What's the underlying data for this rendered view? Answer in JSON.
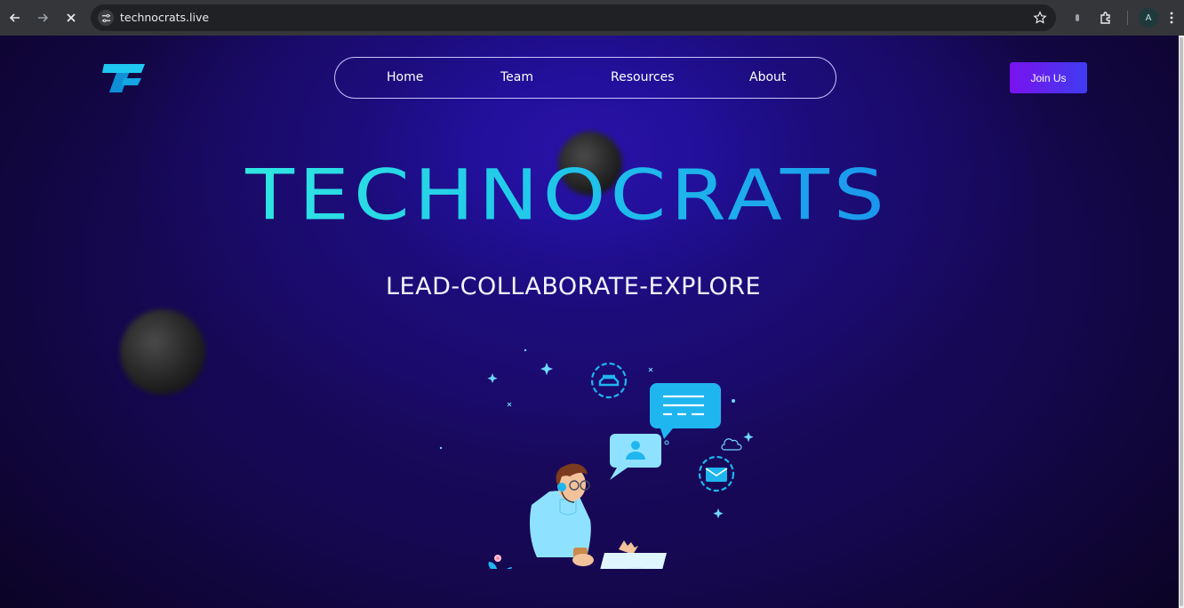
{
  "browser": {
    "url": "technocrats.live",
    "profile_initial": "A",
    "icons": [
      "back-icon",
      "forward-icon",
      "close-icon",
      "tune-icon",
      "star-icon",
      "extension-puzzle-icon",
      "menu-dots-icon"
    ]
  },
  "nav": {
    "items": [
      "Home",
      "Team",
      "Resources",
      "About"
    ]
  },
  "cta": {
    "join_label": "Join Us"
  },
  "hero": {
    "title": "TECHNOCRATS",
    "subtitle": "LEAD-COLLABORATE-EXPLORE"
  },
  "colors": {
    "accent_cyan": "#2fe6e2",
    "accent_blue": "#1a8fee",
    "button_purple": "#7a12ee",
    "background": "#1b0d4a"
  }
}
